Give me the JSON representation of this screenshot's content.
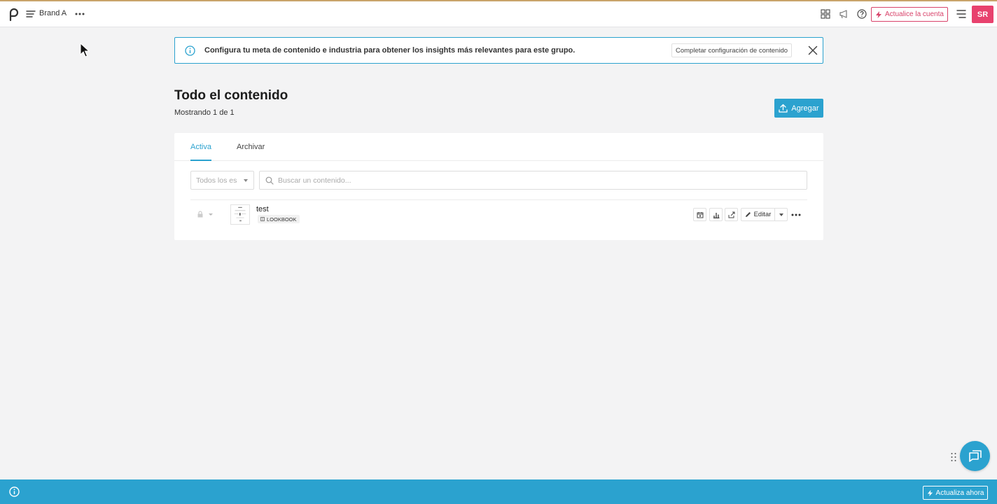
{
  "topbar": {
    "brand_name": "Brand A",
    "upgrade_label": "Actualice la cuenta",
    "avatar_initials": "SR",
    "accent_color": "#e8426e"
  },
  "banner": {
    "message": "Configura tu meta de contenido e industria para obtener los insights más relevantes para este grupo.",
    "action_label": "Completar configuración de contenido"
  },
  "page": {
    "title": "Todo el contenido",
    "subtitle": "Mostrando 1 de 1",
    "add_label": "Agregar"
  },
  "tabs": [
    {
      "label": "Activa",
      "active": true
    },
    {
      "label": "Archivar",
      "active": false
    }
  ],
  "filters": {
    "state_select_value": "Todos los es",
    "search_placeholder": "Buscar un contenido..."
  },
  "content_items": [
    {
      "title": "test",
      "tag": "LOOKBOOK",
      "edit_label": "Editar"
    }
  ],
  "bottombar": {
    "upgrade_now_label": "Actualiza ahora"
  },
  "theme": {
    "primary": "#2ba2cf",
    "danger": "#d8436a"
  }
}
